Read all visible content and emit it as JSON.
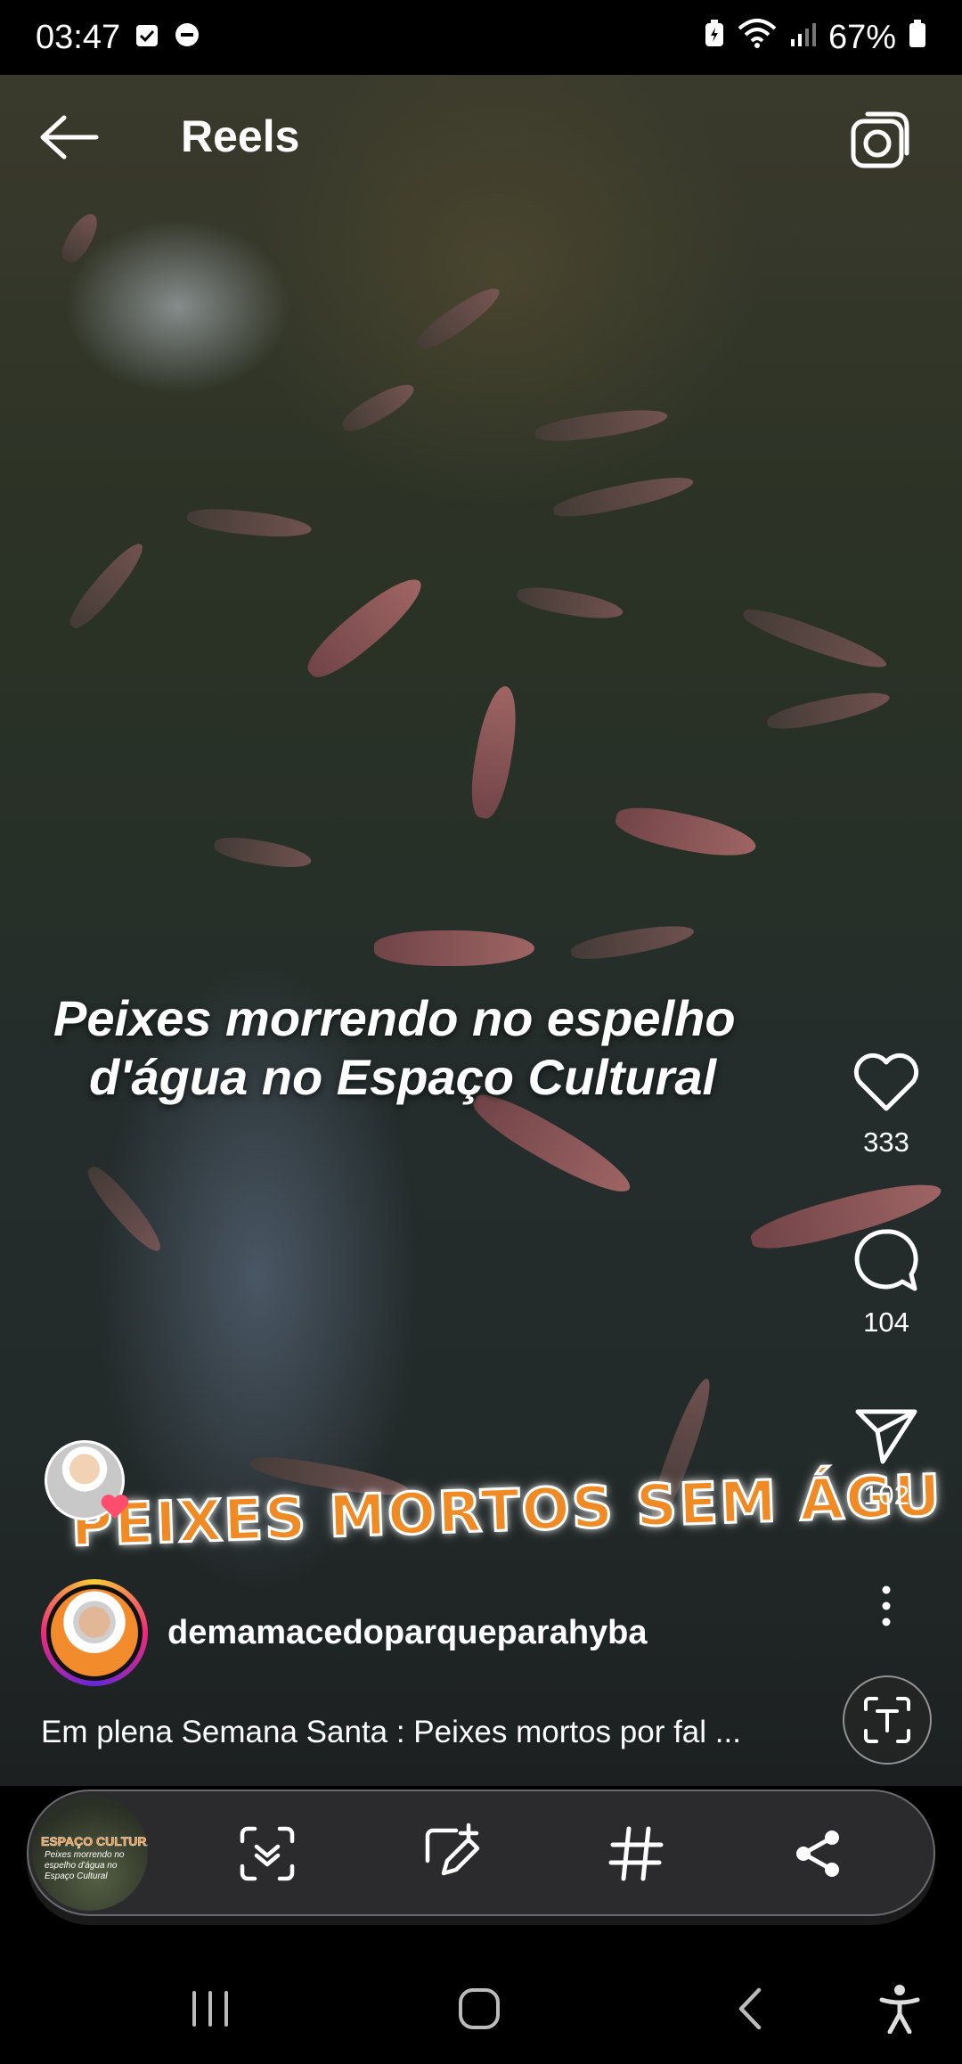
{
  "status_bar": {
    "time": "03:47",
    "battery": "67%"
  },
  "header": {
    "title": "Reels"
  },
  "video": {
    "overlay_line1": "Peixes morrendo no espelho",
    "overlay_line2": "d'água no Espaço Cultural",
    "sticker_text": "PEIXES MORTOS SEM ÁGU"
  },
  "actions": {
    "likes": "333",
    "comments": "104",
    "shares": "102"
  },
  "author": {
    "username": "demamacedoparqueparahyba"
  },
  "caption": "Em plena Semana Santa : Peixes mortos por fal ...",
  "toolbar": {
    "thumb_title": "ESPAÇO CULTURAL",
    "thumb_subtitle": "Peixes morrendo no espelho d'água no Espaço Cultural"
  },
  "icons": {
    "status": [
      "checkbox-icon",
      "dnd-icon",
      "battery-saver-icon",
      "wifi-icon",
      "signal-icon",
      "battery-icon"
    ],
    "header": [
      "back-arrow-icon",
      "camera-icon"
    ],
    "actions": [
      "heart-icon",
      "comment-icon",
      "send-icon",
      "more-icon",
      "text-icon"
    ],
    "toolbar": [
      "scan-icon",
      "edit-icon",
      "hashtag-icon",
      "share-icon"
    ],
    "nav": [
      "recents-icon",
      "home-icon",
      "back-icon",
      "accessibility-icon"
    ]
  },
  "colors": {
    "sticker_orange": "#f08a24",
    "background": "#000000",
    "toolbar": "#2b2b2d"
  }
}
